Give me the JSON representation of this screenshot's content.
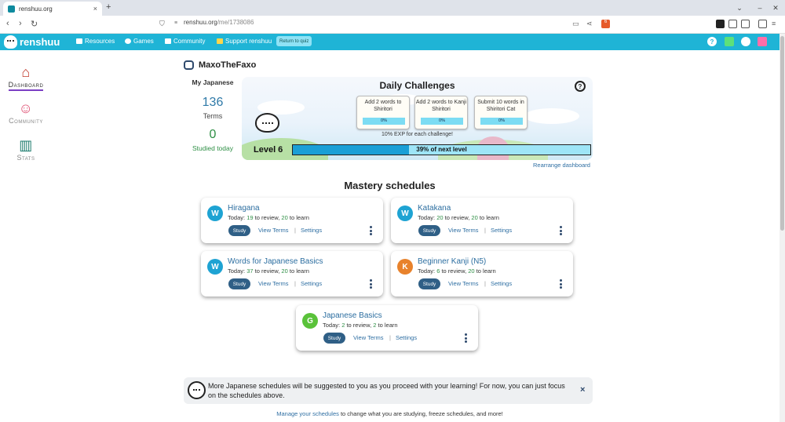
{
  "browser": {
    "tab_title": "renshuu.org",
    "tab_close": "×",
    "new_tab": "+",
    "url_host": "renshuu.org",
    "url_path": "/me/1738086",
    "back": "‹",
    "forward": "›",
    "reload": "↻",
    "ext_badge_1": "6",
    "ext_badge_2": "1"
  },
  "header": {
    "logo": "renshuu",
    "nav": [
      "Resources",
      "Games",
      "Community",
      "Support renshuu"
    ],
    "return_quiz": "Return to quiz",
    "help_icon": "?"
  },
  "leftnav": [
    {
      "label": "Dashboard",
      "icon": "house-icon"
    },
    {
      "label": "Community",
      "icon": "community-icon"
    },
    {
      "label": "Stats",
      "icon": "stats-icon"
    }
  ],
  "profile": {
    "username": "MaxoTheFaxo",
    "my_japanese": "My Japanese",
    "terms_count": "136",
    "terms_label": "Terms",
    "studied_count": "0",
    "studied_label": "Studied today"
  },
  "daily": {
    "title": "Daily Challenges",
    "help": "?",
    "challenges": [
      {
        "text": "Add 2 words to Shiritori",
        "progress": "0%"
      },
      {
        "text": "Add 2 words to Kanji Shiritori",
        "progress": "0%"
      },
      {
        "text": "Submit 10 words in Shiritori Cat",
        "progress": "0%"
      }
    ],
    "exp_note": "10% EXP for each challenge!",
    "level": "Level 6",
    "level_progress_text": "39% of next level",
    "level_progress": 0.39,
    "rearrange": "Rearrange dashboard"
  },
  "mastery": {
    "title": "Mastery schedules",
    "today_prefix": "Today:",
    "to_review": "to review,",
    "to_learn": "to learn",
    "study": "Study",
    "view_terms": "View Terms",
    "separator": "|",
    "settings": "Settings",
    "schedules": [
      {
        "badge": "W",
        "badge_color": "#1ea3d3",
        "title": "Hiragana",
        "review": "19",
        "learn": "20"
      },
      {
        "badge": "W",
        "badge_color": "#1ea3d3",
        "title": "Katakana",
        "review": "20",
        "learn": "20"
      },
      {
        "badge": "W",
        "badge_color": "#1ea3d3",
        "title": "Words for Japanese Basics",
        "review": "37",
        "learn": "20"
      },
      {
        "badge": "K",
        "badge_color": "#e8822c",
        "title": "Beginner Kanji (N5)",
        "review": "6",
        "learn": "20"
      },
      {
        "badge": "G",
        "badge_color": "#5ac23a",
        "title": "Japanese Basics",
        "review": "2",
        "learn": "2"
      }
    ]
  },
  "notice": {
    "text": "More Japanese schedules will be suggested to you as you proceed with your learning! For now, you can just focus on the schedules above.",
    "close": "×"
  },
  "footer": {
    "manage_link": "Manage your schedules",
    "manage_rest": " to change what you are studying, freeze schedules, and more!"
  }
}
